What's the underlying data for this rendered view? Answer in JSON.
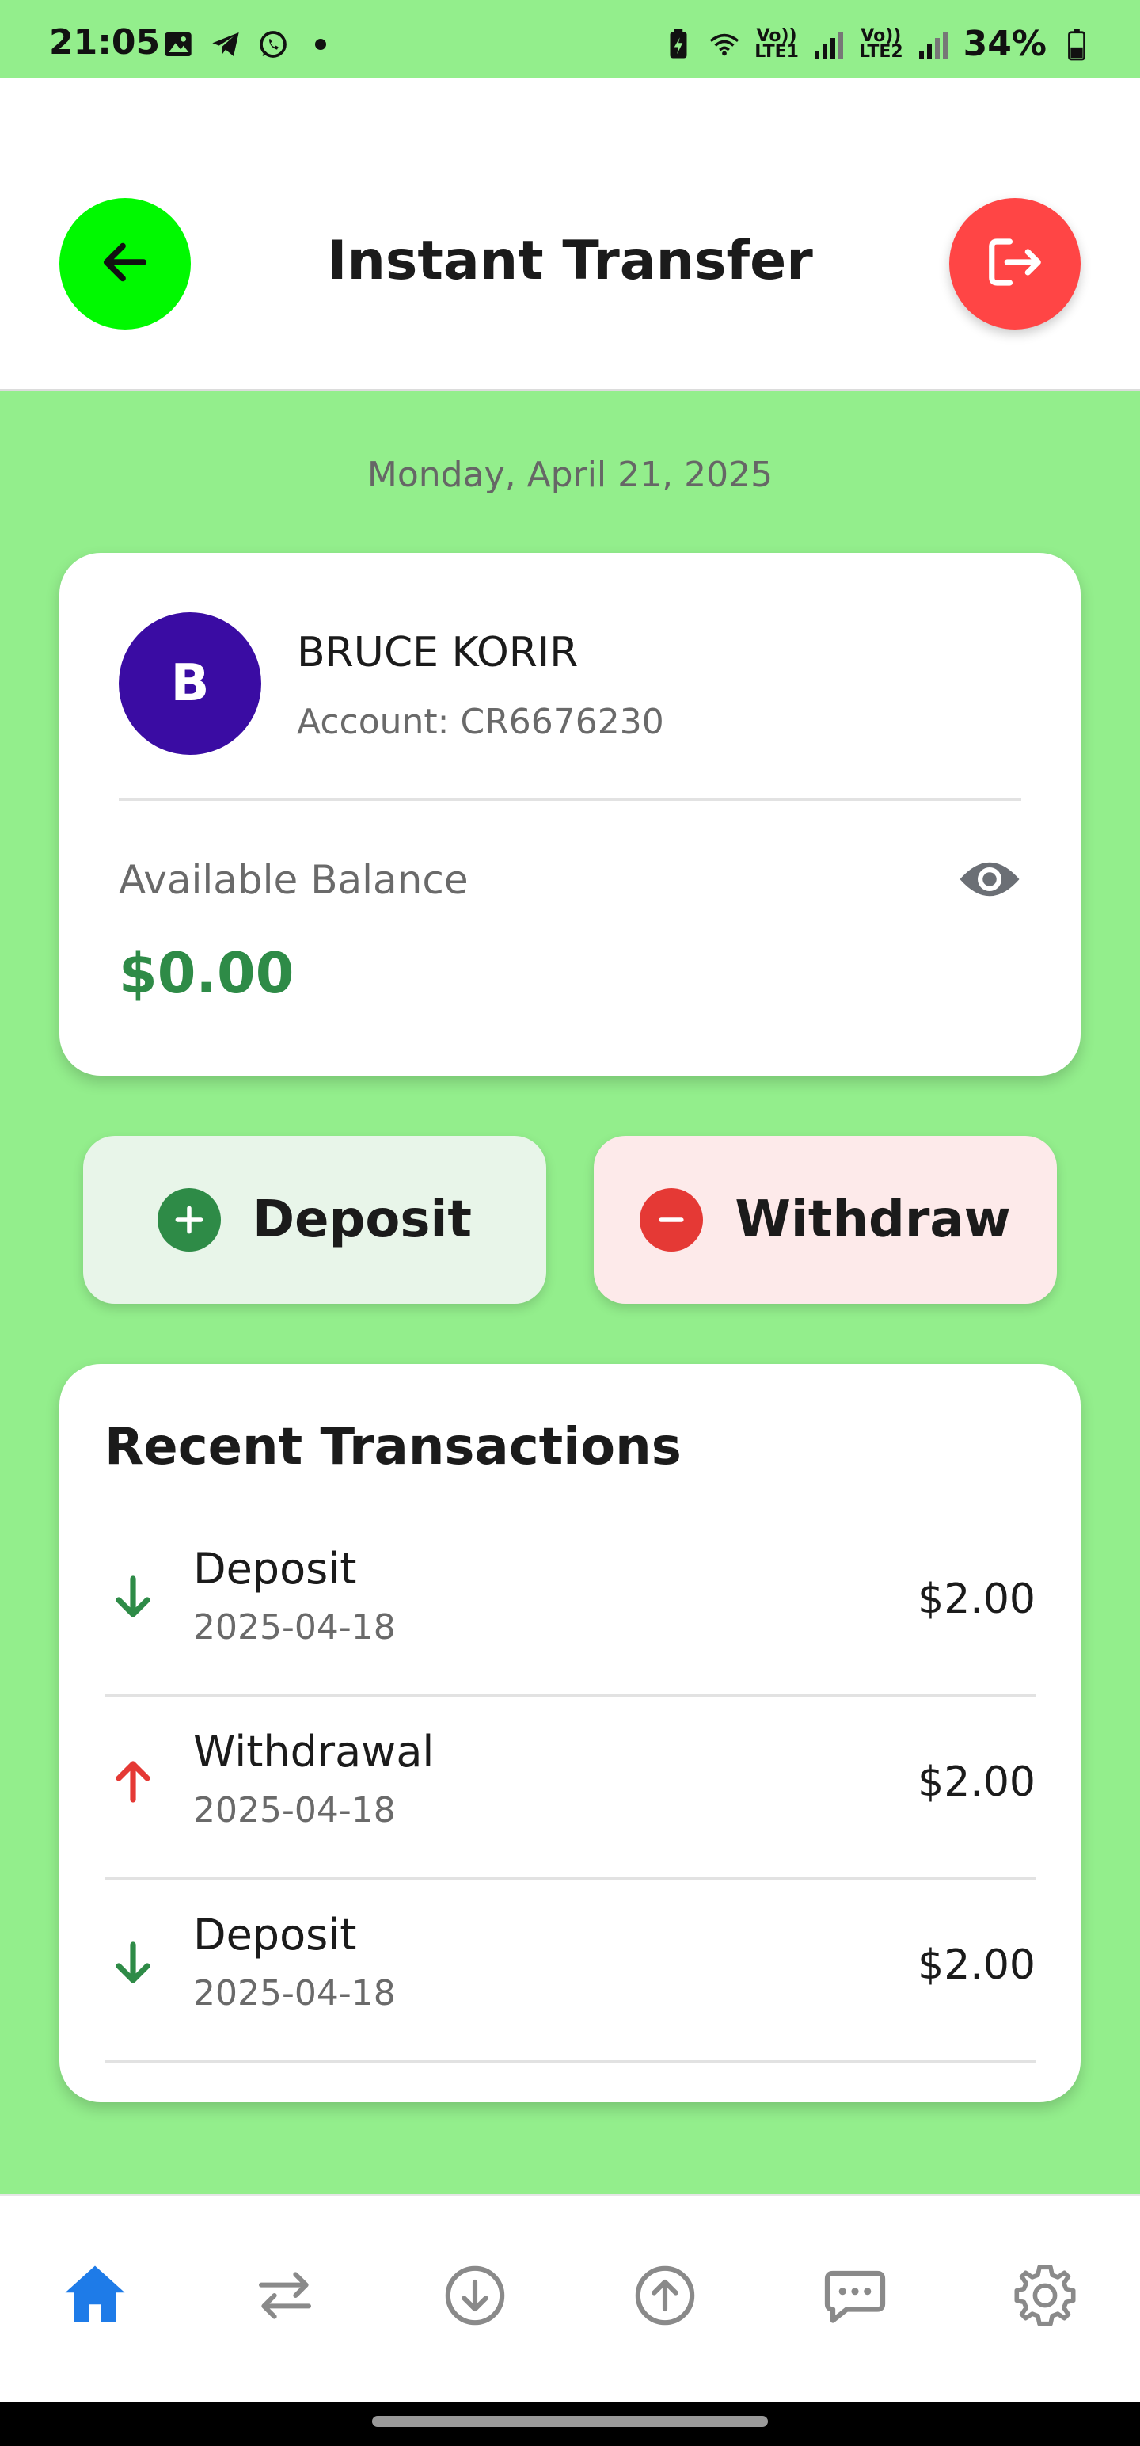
{
  "status_bar": {
    "time": "21:05",
    "left_icons": [
      "gallery-icon",
      "telegram-icon",
      "whatsapp-icon",
      "dot-icon"
    ],
    "network_1": "Vo))\nLTE1",
    "network_2": "Vo))\nLTE2",
    "battery": "34%"
  },
  "header": {
    "title": "Instant Transfer",
    "back_icon": "arrow-left-icon",
    "logout_icon": "logout-icon",
    "back_color": "#00f900",
    "logout_color": "#ff4545"
  },
  "date": "Monday, April 21, 2025",
  "account": {
    "avatar_letter": "B",
    "avatar_color": "#3a0ca3",
    "name": "BRUCE KORIR",
    "account_number": "Account: CR6676230",
    "balance_label": "Available Balance",
    "balance_value": "$0.00",
    "balance_color": "#2e8b47"
  },
  "actions": {
    "deposit_label": "Deposit",
    "withdraw_label": "Withdraw",
    "deposit_color": "#2e8b47",
    "withdraw_color": "#e53935"
  },
  "transactions": {
    "title": "Recent Transactions",
    "items": [
      {
        "type": "Deposit",
        "date": "2025-04-18",
        "amount": "$2.00",
        "direction": "down"
      },
      {
        "type": "Withdrawal",
        "date": "2025-04-18",
        "amount": "$2.00",
        "direction": "up"
      },
      {
        "type": "Deposit",
        "date": "2025-04-18",
        "amount": "$2.00",
        "direction": "down"
      }
    ]
  },
  "bottom_nav": {
    "items": [
      "home-icon",
      "transfer-icon",
      "deposit-icon",
      "withdraw-icon",
      "chat-icon",
      "settings-icon"
    ],
    "active": "home-icon",
    "active_color": "#1e7be8",
    "inactive_color": "#8a8a8a"
  }
}
